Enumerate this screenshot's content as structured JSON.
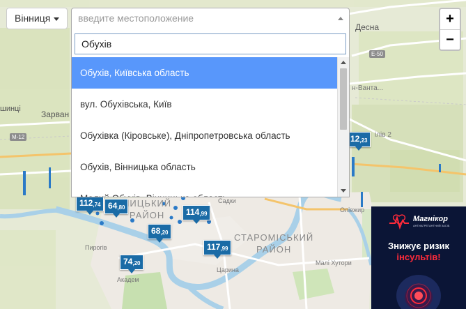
{
  "city_selector": {
    "label": "Вінниця",
    "icon": "caret-down-icon"
  },
  "location_select": {
    "placeholder": "введите местоположение",
    "search_value": "Обухів",
    "options": [
      "Обухів, Київська область",
      "вул. Обухівська, Київ",
      "Обухівка (Кіровське), Дніпропетровська область",
      "Обухів, Вінницька область",
      "Малий Обухів, Вінницька область"
    ],
    "highlighted_index": 0
  },
  "zoom": {
    "in": "+",
    "out": "−"
  },
  "markers": [
    {
      "whole": "112",
      "dec": ",74"
    },
    {
      "whole": "64",
      "dec": ",80"
    },
    {
      "whole": "114",
      "dec": ",99"
    },
    {
      "whole": "68",
      "dec": ",20"
    },
    {
      "whole": "117",
      "dec": ",99"
    },
    {
      "whole": "74",
      "dec": ",20"
    },
    {
      "whole": "12",
      "dec": ",23"
    }
  ],
  "map_labels": {
    "desna": "Десна",
    "zarvan": "Зарван",
    "shyntsi": "шинці",
    "vantazhna": "н-Ванта...",
    "lishi": "ілів 2",
    "oliezhyr": "Оліежир",
    "sadky": "Садки",
    "pyrohiv": "Пирогів",
    "akadem": "Академ",
    "tsaryna": "Царина",
    "maly_khutir": "Малі Хутори",
    "district_left": [
      "НИЦЬКИЙ",
      "РАЙОН"
    ],
    "district_right": [
      "СТАРОМІСЬКИЙ",
      "РАЙОН"
    ]
  },
  "road_labels": {
    "e50": "E-50",
    "m12": "M-12"
  },
  "ad": {
    "brand": "Магнікор",
    "tagline": "АНТИАГРЕГАНТНИЙ ЗАСІБ",
    "line1": "Знижує ризик",
    "line2": "інсультів!",
    "accent": "#ff2a3a"
  }
}
